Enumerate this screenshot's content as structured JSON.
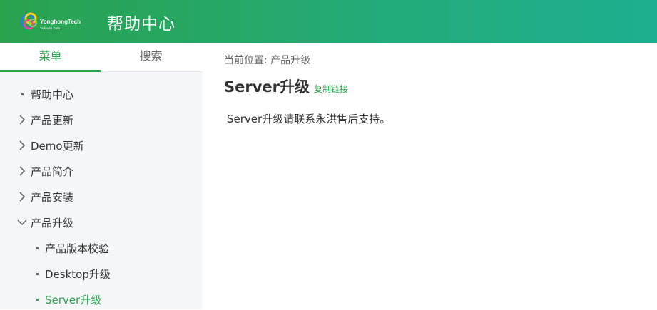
{
  "header": {
    "logo_text": "YonghongTech",
    "logo_sub": "Talk with Data",
    "title": "帮助中心"
  },
  "sidebar": {
    "tabs": [
      {
        "label": "菜单",
        "active": true
      },
      {
        "label": "搜索",
        "active": false
      }
    ],
    "items": [
      {
        "label": "帮助中心",
        "marker": "dot"
      },
      {
        "label": "产品更新",
        "marker": "chevron-right"
      },
      {
        "label": "Demo更新",
        "marker": "chevron-right"
      },
      {
        "label": "产品简介",
        "marker": "chevron-right"
      },
      {
        "label": "产品安装",
        "marker": "chevron-right"
      },
      {
        "label": "产品升级",
        "marker": "chevron-down"
      },
      {
        "label": "产品版本校验",
        "marker": "dot"
      },
      {
        "label": "Desktop升级",
        "marker": "dot"
      },
      {
        "label": "Server升级",
        "marker": "dot",
        "active": true
      }
    ]
  },
  "main": {
    "breadcrumb": "当前位置:  产品升级",
    "title": "Server升级",
    "copy_link": "复制链接",
    "content": "Server升级请联系永洪售后支持。"
  },
  "colors": {
    "accent": "#2aa24e",
    "header_gradient_end": "#1eaf90",
    "sidebar_bg": "#f5f6f7"
  }
}
